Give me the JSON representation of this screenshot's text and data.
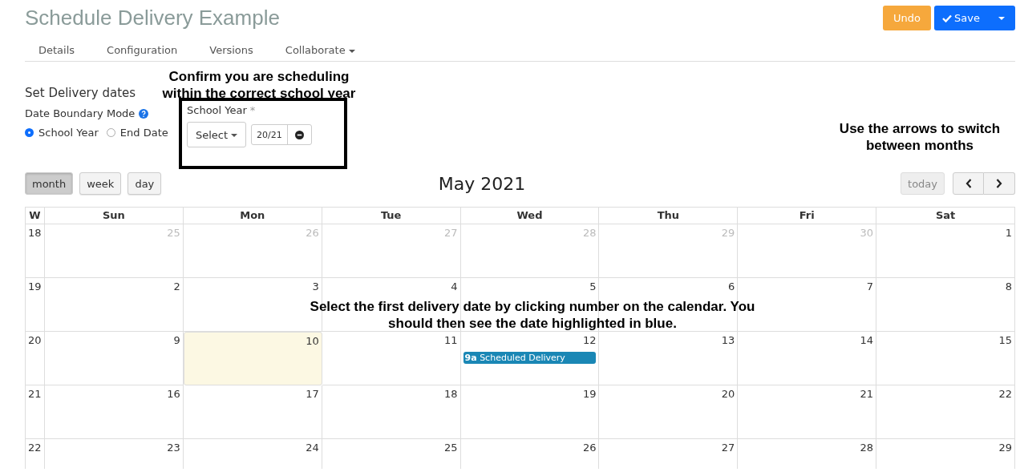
{
  "title": "Schedule Delivery Example",
  "actions": [
    {
      "kind": "undo",
      "label": "Undo"
    },
    {
      "kind": "save",
      "label": "Save"
    }
  ],
  "tabs": [
    {
      "label": "Details",
      "dropdown": false
    },
    {
      "label": "Configuration",
      "dropdown": false
    },
    {
      "label": "Versions",
      "dropdown": false
    },
    {
      "label": "Collaborate",
      "dropdown": true
    }
  ],
  "section_title": "Set Delivery dates",
  "boundary_mode": {
    "label": "Date Boundary Mode",
    "options": [
      {
        "label": "School Year",
        "selected": true
      },
      {
        "label": "End Date",
        "selected": false
      }
    ]
  },
  "school_year": {
    "label": "School Year",
    "required_mark": "*",
    "select_label": "Select",
    "value": "20/21"
  },
  "views": [
    {
      "label": "month",
      "selected": true
    },
    {
      "label": "week",
      "selected": false
    },
    {
      "label": "day",
      "selected": false
    }
  ],
  "month_title": "May 2021",
  "today_label": "today",
  "calendar": {
    "week_header": "W",
    "day_headers": [
      "Sun",
      "Mon",
      "Tue",
      "Wed",
      "Thu",
      "Fri",
      "Sat"
    ],
    "weeks": [
      {
        "week": "18",
        "days": [
          {
            "day": "25",
            "other_month": true,
            "today": false
          },
          {
            "day": "26",
            "other_month": true,
            "today": false
          },
          {
            "day": "27",
            "other_month": true,
            "today": false
          },
          {
            "day": "28",
            "other_month": true,
            "today": false
          },
          {
            "day": "29",
            "other_month": true,
            "today": false
          },
          {
            "day": "30",
            "other_month": true,
            "today": false
          },
          {
            "day": "1",
            "other_month": false,
            "today": false
          }
        ]
      },
      {
        "week": "19",
        "days": [
          {
            "day": "2",
            "other_month": false,
            "today": false
          },
          {
            "day": "3",
            "other_month": false,
            "today": false
          },
          {
            "day": "4",
            "other_month": false,
            "today": false
          },
          {
            "day": "5",
            "other_month": false,
            "today": false
          },
          {
            "day": "6",
            "other_month": false,
            "today": false
          },
          {
            "day": "7",
            "other_month": false,
            "today": false
          },
          {
            "day": "8",
            "other_month": false,
            "today": false
          }
        ]
      },
      {
        "week": "20",
        "days": [
          {
            "day": "9",
            "other_month": false,
            "today": false
          },
          {
            "day": "10",
            "other_month": false,
            "today": true
          },
          {
            "day": "11",
            "other_month": false,
            "today": false
          },
          {
            "day": "12",
            "other_month": false,
            "today": false,
            "events": [
              {
                "time": "9a",
                "title": "Scheduled Delivery"
              }
            ]
          },
          {
            "day": "13",
            "other_month": false,
            "today": false
          },
          {
            "day": "14",
            "other_month": false,
            "today": false
          },
          {
            "day": "15",
            "other_month": false,
            "today": false
          }
        ]
      },
      {
        "week": "21",
        "days": [
          {
            "day": "16",
            "other_month": false,
            "today": false
          },
          {
            "day": "17",
            "other_month": false,
            "today": false
          },
          {
            "day": "18",
            "other_month": false,
            "today": false
          },
          {
            "day": "19",
            "other_month": false,
            "today": false
          },
          {
            "day": "20",
            "other_month": false,
            "today": false
          },
          {
            "day": "21",
            "other_month": false,
            "today": false
          },
          {
            "day": "22",
            "other_month": false,
            "today": false
          }
        ]
      },
      {
        "week": "22",
        "days": [
          {
            "day": "23",
            "other_month": false,
            "today": false
          },
          {
            "day": "24",
            "other_month": false,
            "today": false
          },
          {
            "day": "25",
            "other_month": false,
            "today": false
          },
          {
            "day": "26",
            "other_month": false,
            "today": false
          },
          {
            "day": "27",
            "other_month": false,
            "today": false
          },
          {
            "day": "28",
            "other_month": false,
            "today": false
          },
          {
            "day": "29",
            "other_month": false,
            "today": false
          }
        ]
      }
    ]
  },
  "annotations": [
    "Confirm you are scheduling within the correct school year",
    "Use the arrows to switch between months",
    "Select the first delivery date by clicking number on the calendar. You should then see the date highlighted in blue."
  ]
}
